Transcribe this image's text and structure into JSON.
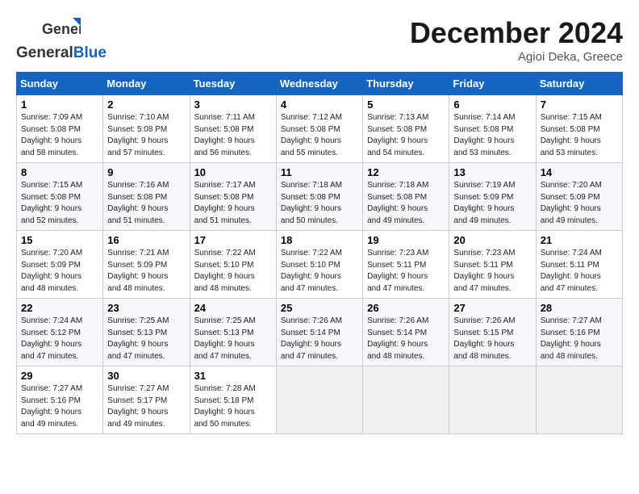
{
  "header": {
    "logo_general": "General",
    "logo_blue": "Blue",
    "month_title": "December 2024",
    "location": "Agioi Deka, Greece"
  },
  "weekdays": [
    "Sunday",
    "Monday",
    "Tuesday",
    "Wednesday",
    "Thursday",
    "Friday",
    "Saturday"
  ],
  "weeks": [
    [
      {
        "day": "1",
        "info": "Sunrise: 7:09 AM\nSunset: 5:08 PM\nDaylight: 9 hours\nand 58 minutes."
      },
      {
        "day": "2",
        "info": "Sunrise: 7:10 AM\nSunset: 5:08 PM\nDaylight: 9 hours\nand 57 minutes."
      },
      {
        "day": "3",
        "info": "Sunrise: 7:11 AM\nSunset: 5:08 PM\nDaylight: 9 hours\nand 56 minutes."
      },
      {
        "day": "4",
        "info": "Sunrise: 7:12 AM\nSunset: 5:08 PM\nDaylight: 9 hours\nand 55 minutes."
      },
      {
        "day": "5",
        "info": "Sunrise: 7:13 AM\nSunset: 5:08 PM\nDaylight: 9 hours\nand 54 minutes."
      },
      {
        "day": "6",
        "info": "Sunrise: 7:14 AM\nSunset: 5:08 PM\nDaylight: 9 hours\nand 53 minutes."
      },
      {
        "day": "7",
        "info": "Sunrise: 7:15 AM\nSunset: 5:08 PM\nDaylight: 9 hours\nand 53 minutes."
      }
    ],
    [
      {
        "day": "8",
        "info": "Sunrise: 7:15 AM\nSunset: 5:08 PM\nDaylight: 9 hours\nand 52 minutes."
      },
      {
        "day": "9",
        "info": "Sunrise: 7:16 AM\nSunset: 5:08 PM\nDaylight: 9 hours\nand 51 minutes."
      },
      {
        "day": "10",
        "info": "Sunrise: 7:17 AM\nSunset: 5:08 PM\nDaylight: 9 hours\nand 51 minutes."
      },
      {
        "day": "11",
        "info": "Sunrise: 7:18 AM\nSunset: 5:08 PM\nDaylight: 9 hours\nand 50 minutes."
      },
      {
        "day": "12",
        "info": "Sunrise: 7:18 AM\nSunset: 5:08 PM\nDaylight: 9 hours\nand 49 minutes."
      },
      {
        "day": "13",
        "info": "Sunrise: 7:19 AM\nSunset: 5:09 PM\nDaylight: 9 hours\nand 49 minutes."
      },
      {
        "day": "14",
        "info": "Sunrise: 7:20 AM\nSunset: 5:09 PM\nDaylight: 9 hours\nand 49 minutes."
      }
    ],
    [
      {
        "day": "15",
        "info": "Sunrise: 7:20 AM\nSunset: 5:09 PM\nDaylight: 9 hours\nand 48 minutes."
      },
      {
        "day": "16",
        "info": "Sunrise: 7:21 AM\nSunset: 5:09 PM\nDaylight: 9 hours\nand 48 minutes."
      },
      {
        "day": "17",
        "info": "Sunrise: 7:22 AM\nSunset: 5:10 PM\nDaylight: 9 hours\nand 48 minutes."
      },
      {
        "day": "18",
        "info": "Sunrise: 7:22 AM\nSunset: 5:10 PM\nDaylight: 9 hours\nand 47 minutes."
      },
      {
        "day": "19",
        "info": "Sunrise: 7:23 AM\nSunset: 5:11 PM\nDaylight: 9 hours\nand 47 minutes."
      },
      {
        "day": "20",
        "info": "Sunrise: 7:23 AM\nSunset: 5:11 PM\nDaylight: 9 hours\nand 47 minutes."
      },
      {
        "day": "21",
        "info": "Sunrise: 7:24 AM\nSunset: 5:11 PM\nDaylight: 9 hours\nand 47 minutes."
      }
    ],
    [
      {
        "day": "22",
        "info": "Sunrise: 7:24 AM\nSunset: 5:12 PM\nDaylight: 9 hours\nand 47 minutes."
      },
      {
        "day": "23",
        "info": "Sunrise: 7:25 AM\nSunset: 5:13 PM\nDaylight: 9 hours\nand 47 minutes."
      },
      {
        "day": "24",
        "info": "Sunrise: 7:25 AM\nSunset: 5:13 PM\nDaylight: 9 hours\nand 47 minutes."
      },
      {
        "day": "25",
        "info": "Sunrise: 7:26 AM\nSunset: 5:14 PM\nDaylight: 9 hours\nand 47 minutes."
      },
      {
        "day": "26",
        "info": "Sunrise: 7:26 AM\nSunset: 5:14 PM\nDaylight: 9 hours\nand 48 minutes."
      },
      {
        "day": "27",
        "info": "Sunrise: 7:26 AM\nSunset: 5:15 PM\nDaylight: 9 hours\nand 48 minutes."
      },
      {
        "day": "28",
        "info": "Sunrise: 7:27 AM\nSunset: 5:16 PM\nDaylight: 9 hours\nand 48 minutes."
      }
    ],
    [
      {
        "day": "29",
        "info": "Sunrise: 7:27 AM\nSunset: 5:16 PM\nDaylight: 9 hours\nand 49 minutes."
      },
      {
        "day": "30",
        "info": "Sunrise: 7:27 AM\nSunset: 5:17 PM\nDaylight: 9 hours\nand 49 minutes."
      },
      {
        "day": "31",
        "info": "Sunrise: 7:28 AM\nSunset: 5:18 PM\nDaylight: 9 hours\nand 50 minutes."
      },
      {
        "day": "",
        "info": ""
      },
      {
        "day": "",
        "info": ""
      },
      {
        "day": "",
        "info": ""
      },
      {
        "day": "",
        "info": ""
      }
    ]
  ]
}
